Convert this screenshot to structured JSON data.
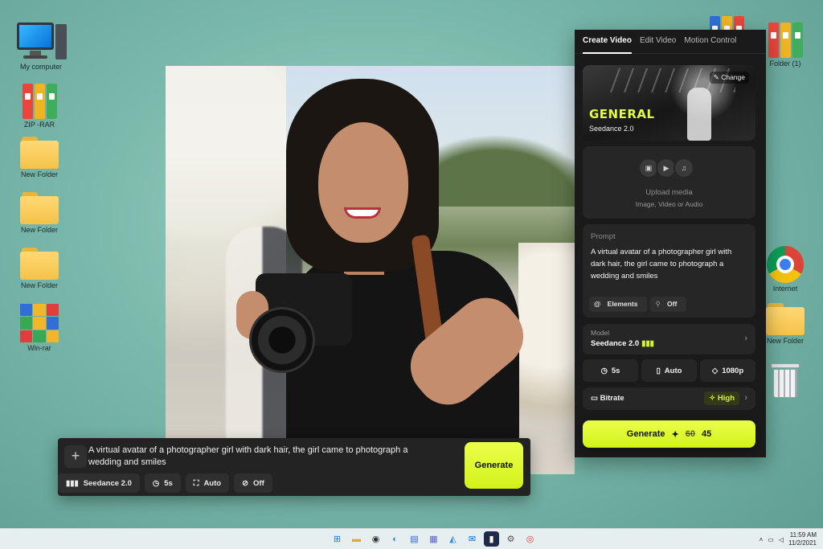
{
  "desktop_icons": [
    {
      "label": "My computer"
    },
    {
      "label": "ZIP -RAR"
    },
    {
      "label": "New Folder"
    },
    {
      "label": "New Folder"
    },
    {
      "label": "New Folder"
    },
    {
      "label": "Win-rar"
    },
    {
      "label": "Folder (1)"
    },
    {
      "label": "Internet"
    },
    {
      "label": "New Folder"
    },
    {
      "label": ""
    }
  ],
  "bottom_bar": {
    "plus_icon": "+",
    "prompt_text": "A virtual avatar of a photographer girl with dark hair, the girl came to photograph a wedding and smiles",
    "chips": [
      {
        "icon": "signal-bars-icon",
        "label": "Seedance 2.0"
      },
      {
        "icon": "clock-icon",
        "label": "5s"
      },
      {
        "icon": "aspect-icon",
        "label": "Auto"
      },
      {
        "icon": "mute-icon",
        "label": "Off"
      }
    ],
    "generate_label": "Generate"
  },
  "panel": {
    "tabs": [
      "Create Video",
      "Edit Video",
      "Motion Control"
    ],
    "active_tab": "Create Video",
    "model_card": {
      "change_label": "Change",
      "title": "GENERAL",
      "model_name": "Seedance 2.0"
    },
    "upload": {
      "title": "Upload media",
      "subtitle": "Image, Video or Audio"
    },
    "prompt": {
      "label": "Prompt",
      "text": "A virtual avatar of a photographer girl with dark hair, the girl came to photograph a wedding and smiles",
      "elements_label": "Elements",
      "off_label": "Off"
    },
    "model_select": {
      "label": "Model",
      "value": "Seedance 2.0"
    },
    "settings": [
      {
        "icon": "clock-icon",
        "label": "5s"
      },
      {
        "icon": "aspect-icon",
        "label": "Auto"
      },
      {
        "icon": "tag-icon",
        "label": "1080p"
      }
    ],
    "bitrate": {
      "label": "Bitrate",
      "value": "High"
    },
    "generate": {
      "label": "Generate",
      "old_cost": "60",
      "cost": "45"
    }
  },
  "taskbar": {
    "time": "11:59 AM",
    "date": "11/2/2021"
  },
  "colors": {
    "accent": "#d8f32a",
    "panel_bg": "#1a1a1a",
    "card_bg": "#262626"
  }
}
